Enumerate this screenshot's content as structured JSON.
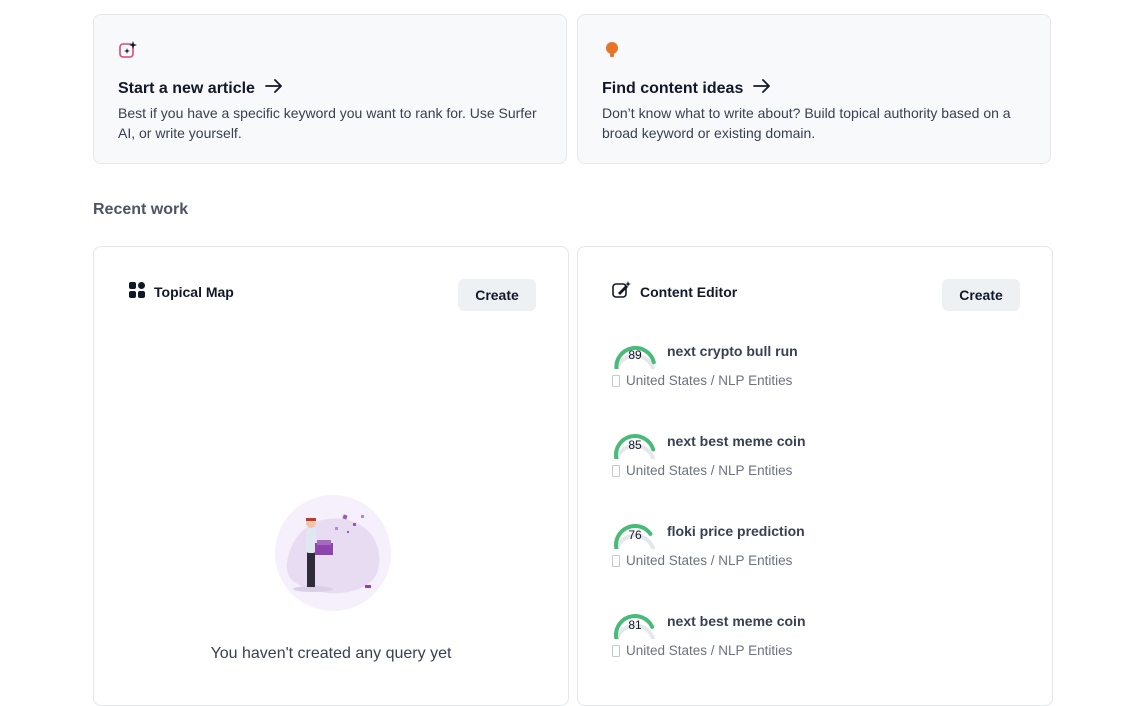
{
  "cards": {
    "new_article": {
      "title": "Start a new article",
      "description": "Best if you have a specific keyword you want to rank for. Use Surfer AI, or write yourself.",
      "icon": "sparkle-square-icon"
    },
    "content_ideas": {
      "title": "Find content ideas",
      "description": "Don’t know what to write about? Build topical authority based on a broad keyword or existing domain.",
      "icon": "lightbulb-icon"
    }
  },
  "recent": {
    "title": "Recent work"
  },
  "topical_map": {
    "title": "Topical Map",
    "create_label": "Create",
    "empty_text": "You haven't created any query yet"
  },
  "content_editor": {
    "title": "Content Editor",
    "create_label": "Create",
    "items": [
      {
        "score": "89",
        "score_value": 89,
        "title": "next crypto bull run",
        "meta": "United States / NLP Entities"
      },
      {
        "score": "85",
        "score_value": 85,
        "title": "next best meme coin",
        "meta": "United States / NLP Entities"
      },
      {
        "score": "76",
        "score_value": 76,
        "title": "floki price prediction",
        "meta": "United States / NLP Entities"
      },
      {
        "score": "81",
        "score_value": 81,
        "title": "next best meme coin",
        "meta": "United States / NLP Entities"
      }
    ]
  },
  "colors": {
    "accent_pink": "#e0457b",
    "bulb_orange": "#e8742a",
    "gauge_green": "#48bb78",
    "gauge_track": "#e5e7eb"
  }
}
